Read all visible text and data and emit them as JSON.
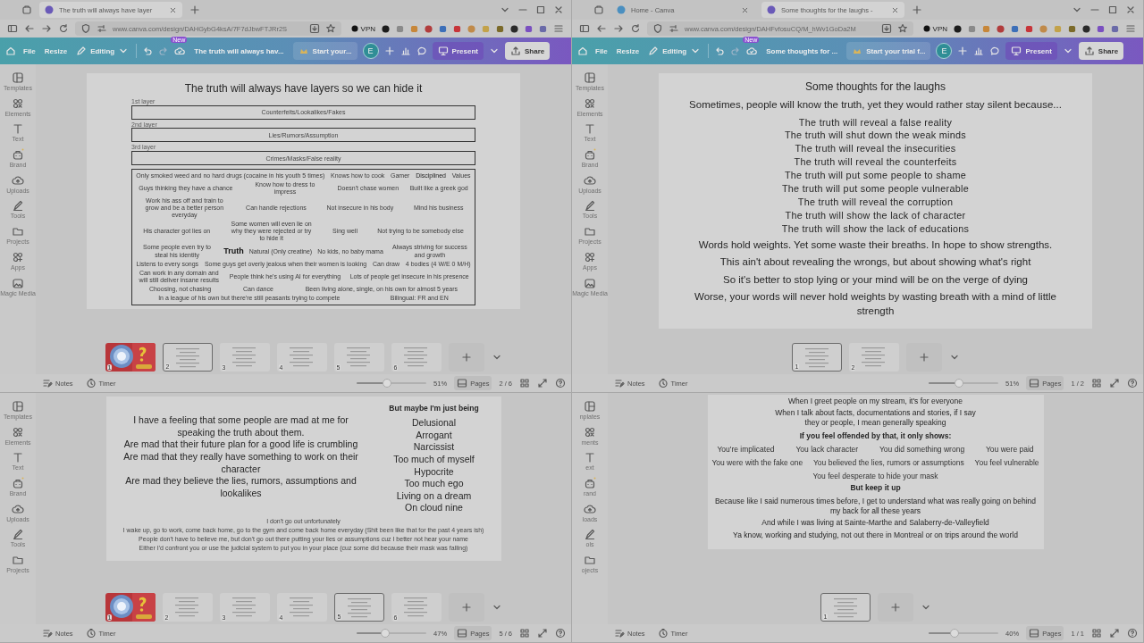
{
  "windows": [
    {
      "browser": {
        "tabs": [
          {
            "title": "The truth will always have layer",
            "selected": true
          }
        ],
        "url": "www.canva.com/design/DAHGybG4ksA/7F7dJbwFTJRr2S",
        "vpn": "VPN"
      },
      "toolbar": {
        "menu": [
          "File",
          "Resize"
        ],
        "mode": "Editing",
        "badge": "New",
        "design_title": "The truth will always hav...",
        "trial": "Start your...",
        "avatar": "E",
        "present": "Present",
        "share": "Share"
      },
      "sidebar": [
        {
          "label": "Templates"
        },
        {
          "label": "Elements"
        },
        {
          "label": "Text"
        },
        {
          "label": "Brand"
        },
        {
          "label": "Uploads"
        },
        {
          "label": "Tools"
        },
        {
          "label": "Projects"
        },
        {
          "label": "Apps"
        },
        {
          "label": "Magic Media"
        }
      ],
      "slide": {
        "blocks": [
          {
            "kind": "title",
            "text": "The truth will always have layers so we can hide it"
          },
          {
            "kind": "layer",
            "label": "1st layer",
            "text": "Counterfeits/Lookalikes/Fakes"
          },
          {
            "kind": "layer",
            "label": "2nd layer",
            "text": "Lies/Rumors/Assumption"
          },
          {
            "kind": "layer",
            "label": "3rd layer",
            "text": "Crimes/Masks/False reality"
          },
          {
            "kind": "cloud",
            "words": [
              {
                "text": "Only smoked weed and no hard drugs (cocaine in his youth 5 times)",
                "kind": "normal"
              },
              {
                "text": "Knows how to cook",
                "kind": "normal"
              },
              {
                "text": "Gamer",
                "kind": "normal"
              },
              {
                "text": "Disciplined",
                "kind": "emph"
              },
              {
                "text": "Values",
                "kind": "normal"
              },
              {
                "text": "Guys thinking they have a chance",
                "kind": "normal"
              },
              {
                "text": "Know how to dress to impress",
                "kind": "small"
              },
              {
                "text": "Doesn't chase women",
                "kind": "normal"
              },
              {
                "text": "Built like a greek god",
                "kind": "normal"
              },
              {
                "text": "Work his ass off and train to grow and be a better person everyday",
                "kind": "small"
              },
              {
                "text": "Can handle rejections",
                "kind": "normal"
              },
              {
                "text": "Not insecure in his body",
                "kind": "normal"
              },
              {
                "text": "Mind his business",
                "kind": "normal"
              },
              {
                "text": "His character got lies on",
                "kind": "normal"
              },
              {
                "text": "Some women will even lie on why they were rejected or try to hide it",
                "kind": "small"
              },
              {
                "text": "Sing well",
                "kind": "normal"
              },
              {
                "text": "Not trying to be somebody else",
                "kind": "normal"
              },
              {
                "text": "Some people even try to steal his identity",
                "kind": "small"
              },
              {
                "text": "Truth",
                "kind": "strong"
              },
              {
                "text": "Natural (Only creatine)",
                "kind": "normal"
              },
              {
                "text": "No kids, no baby mama",
                "kind": "normal"
              },
              {
                "text": "Always striving for success and growth",
                "kind": "small"
              },
              {
                "text": "Listens to every songs",
                "kind": "normal"
              },
              {
                "text": "Some guys get overly jealous when their women is looking",
                "kind": "normal"
              },
              {
                "text": "Can draw",
                "kind": "normal"
              },
              {
                "text": "4 bodies (4 W/E 0 M/H)",
                "kind": "normal"
              },
              {
                "text": "Can work in any domain and will still deliver insane results",
                "kind": "small"
              },
              {
                "text": "People think he's using AI for everything",
                "kind": "normal"
              },
              {
                "text": "Lots of people get insecure in his presence",
                "kind": "normal"
              },
              {
                "text": "Choosing, not chasing",
                "kind": "normal"
              },
              {
                "text": "Can dance",
                "kind": "normal"
              },
              {
                "text": "Been living alone, single, on his own for almost 5 years",
                "kind": "normal"
              },
              {
                "text": "In a league of his own but there're still peasants trying to compete",
                "kind": "normal"
              },
              {
                "text": "Bilingual: FR and EN",
                "kind": "normal"
              }
            ]
          }
        ]
      },
      "pages": [
        {
          "number": "1",
          "kind": "picture",
          "selected": false
        },
        {
          "number": "2",
          "kind": "slide",
          "selected": true
        },
        {
          "number": "3",
          "kind": "slide",
          "selected": false
        },
        {
          "number": "4",
          "kind": "slide",
          "selected": false
        },
        {
          "number": "5",
          "kind": "slide",
          "selected": false
        },
        {
          "number": "6",
          "kind": "slide",
          "selected": false
        }
      ],
      "footer": {
        "notes": "Notes",
        "timer": "Timer",
        "zoom": {
          "level": 0.44
        },
        "zoom_label": "51%",
        "pages": "Pages",
        "page_count": "2 / 6"
      }
    },
    {
      "browser": {
        "tabs": [
          {
            "title": "Home - Canva",
            "selected": false
          },
          {
            "title": "Some thoughts for the laughs -",
            "selected": true
          }
        ],
        "url": "www.canva.com/design/DAHFvfosuCQ/M_hWv1GoDa2M",
        "vpn": "VPN"
      },
      "toolbar": {
        "menu": [
          "File",
          "Resize"
        ],
        "mode": "Editing",
        "badge": "New",
        "design_title": "Some thoughts for ...",
        "trial": "Start your trial f...",
        "avatar": "E",
        "present": "Present",
        "share": "Share"
      },
      "sidebar": [
        {
          "label": "Templates"
        },
        {
          "label": "Elements"
        },
        {
          "label": "Text"
        },
        {
          "label": "Brand"
        },
        {
          "label": "Uploads"
        },
        {
          "label": "Tools"
        },
        {
          "label": "Projects"
        },
        {
          "label": "Apps"
        },
        {
          "label": "Magic Media"
        }
      ],
      "slide": {
        "blocks": [
          {
            "kind": "title",
            "text": "Some thoughts for the laughs"
          },
          {
            "kind": "line",
            "text": "Sometimes, people will know the truth, yet they would rather stay silent because..."
          },
          {
            "kind": "list",
            "items": [
              "The truth will reveal a false reality",
              "The truth will shut down the weak minds",
              "The truth will reveal the insecurities",
              "The truth will reveal the counterfeits",
              "The truth will put some people to shame",
              "The truth will put some people vulnerable",
              "The truth will reveal the corruption",
              "The truth will show the lack of character",
              "The truth will show the lack of educations"
            ]
          },
          {
            "kind": "line",
            "text": "Words hold weights. Yet some waste their breaths. In hope to show strengths."
          },
          {
            "kind": "line",
            "text": "This ain't about revealing the wrongs, but about showing what's right"
          },
          {
            "kind": "line",
            "text": "So it's better to stop lying or your mind will be on the verge of dying"
          },
          {
            "kind": "line",
            "text": "Worse, your words will never hold weights by wasting breath with a mind of little strength"
          }
        ]
      },
      "pages": [
        {
          "number": "1",
          "kind": "slide",
          "selected": true
        },
        {
          "number": "2",
          "kind": "slide",
          "selected": false
        }
      ],
      "footer": {
        "notes": "Notes",
        "timer": "Timer",
        "zoom": {
          "level": 0.44
        },
        "zoom_label": "51%",
        "pages": "Pages",
        "page_count": "1 / 2"
      }
    },
    {
      "sidebar": [
        {
          "label": "Templates"
        },
        {
          "label": "Elements"
        },
        {
          "label": "Text"
        },
        {
          "label": "Brand"
        },
        {
          "label": "Uploads"
        },
        {
          "label": "Tools"
        },
        {
          "label": "Projects"
        }
      ],
      "slide": {
        "blocks": [
          {
            "kind": "columns",
            "left": [
              {
                "kind": "line",
                "text": "I have a feeling that some people are mad at me for speaking the truth about them."
              },
              {
                "kind": "line",
                "text": "Are mad that their future plan for a good life is crumbling"
              },
              {
                "kind": "line",
                "text": "Are mad that they really have something to work on their character"
              },
              {
                "kind": "line",
                "text": "Are mad they believe the lies, rumors, assumptions and lookalikes"
              }
            ],
            "right": [
              {
                "kind": "bold",
                "text": "But maybe I'm just being"
              },
              {
                "kind": "list",
                "items": [
                  "Delusional",
                  "Arrogant",
                  "Narcissist",
                  "Too much of myself",
                  "Hypocrite",
                  "Too much ego",
                  "Living on a dream",
                  "On cloud nine"
                ]
              }
            ]
          },
          {
            "kind": "note",
            "text": "I don't go out unfortunately"
          },
          {
            "kind": "note",
            "text": "I wake up, go to work, come back home, go to the gym and come back home everyday (Shit been like that for the past 4 years ish)"
          },
          {
            "kind": "note",
            "text": "People don't have to believe me, but don't go out there putting your lies or assumptions cuz I better not hear your name"
          },
          {
            "kind": "note",
            "text": "Either I'd confront you or use the judicial system to put you in your place (cuz some did because their mask was falling)"
          }
        ]
      },
      "pages": [
        {
          "number": "1",
          "kind": "picture",
          "selected": false
        },
        {
          "number": "2",
          "kind": "slide",
          "selected": false
        },
        {
          "number": "3",
          "kind": "slide",
          "selected": false
        },
        {
          "number": "4",
          "kind": "slide",
          "selected": false
        },
        {
          "number": "5",
          "kind": "slide",
          "selected": true
        },
        {
          "number": "6",
          "kind": "slide",
          "selected": false
        }
      ],
      "footer": {
        "notes": "Notes",
        "timer": "Timer",
        "zoom": {
          "level": 0.41
        },
        "zoom_label": "47%",
        "pages": "Pages",
        "page_count": "5 / 6"
      }
    },
    {
      "sidebar": [
        {
          "label": "nplates"
        },
        {
          "label": "ments"
        },
        {
          "label": "ext"
        },
        {
          "label": "rand"
        },
        {
          "label": "loads"
        },
        {
          "label": "ols"
        },
        {
          "label": "ojects"
        }
      ],
      "slide": {
        "blocks": [
          {
            "kind": "line",
            "text": "When I greet people on my stream, it's for everyone"
          },
          {
            "kind": "line",
            "text": "When I talk about facts, documentations and stories, if I say they or people, I mean generally speaking"
          },
          {
            "kind": "bold",
            "text": "If you feel offended by that, it only shows:"
          },
          {
            "kind": "grid",
            "items": [
              "You're implicated",
              "You lack character",
              "You did something wrong",
              "You were paid",
              "You were with the fake one",
              "You believed the lies, rumors or assumptions",
              "You feel vulnerable",
              "You feel desperate to hide your mask"
            ]
          },
          {
            "kind": "bold",
            "text": "But keep it up"
          },
          {
            "kind": "line",
            "text": "Because like I said numerous times before, I get to understand what was really going on behind my back for all these years"
          },
          {
            "kind": "line",
            "text": "And while I was living at Sainte-Marthe and Salaberry-de-Valleyfield"
          },
          {
            "kind": "line",
            "text": "Ya know, working and studying, not out there in Montreal or on trips around the world"
          }
        ]
      },
      "pages": [
        {
          "number": "1",
          "kind": "slide",
          "selected": true
        }
      ],
      "footer": {
        "notes": "Notes",
        "timer": "Timer",
        "zoom": {
          "level": 0.37
        },
        "zoom_label": "40%",
        "pages": "Pages",
        "page_count": "1 / 1"
      }
    }
  ]
}
